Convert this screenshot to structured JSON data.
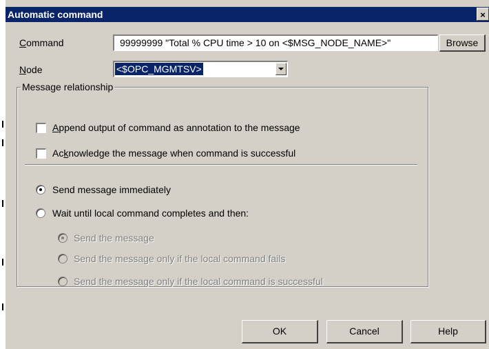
{
  "window": {
    "title": "Automatic command",
    "close_glyph": "×"
  },
  "command": {
    "label_mn": "C",
    "label_rest": "ommand",
    "value": "99999999 \"Total % CPU time > 10 on <$MSG_NODE_NAME>\"",
    "browse_label": "Browse"
  },
  "node": {
    "label_mn": "N",
    "label_rest": "ode",
    "selected": "<$OPC_MGMTSV>"
  },
  "message_relationship": {
    "title": "Message relationship",
    "append_pre": "",
    "append_mn": "A",
    "append_post": "ppend output of command as annotation to the message",
    "append_checked": false,
    "ack_pre": "Ac",
    "ack_mn": "k",
    "ack_post": "nowledge the message when command is successful",
    "ack_checked": false,
    "send_immediately": "Send message immediately",
    "wait_until": "Wait until local command completes and then:",
    "sub_options": [
      "Send the message",
      "Send the message only if the local command fails",
      "Send the message only if the local command is successful"
    ],
    "selected": "send_immediately"
  },
  "buttons": {
    "ok": "OK",
    "cancel": "Cancel",
    "help": "Help"
  }
}
